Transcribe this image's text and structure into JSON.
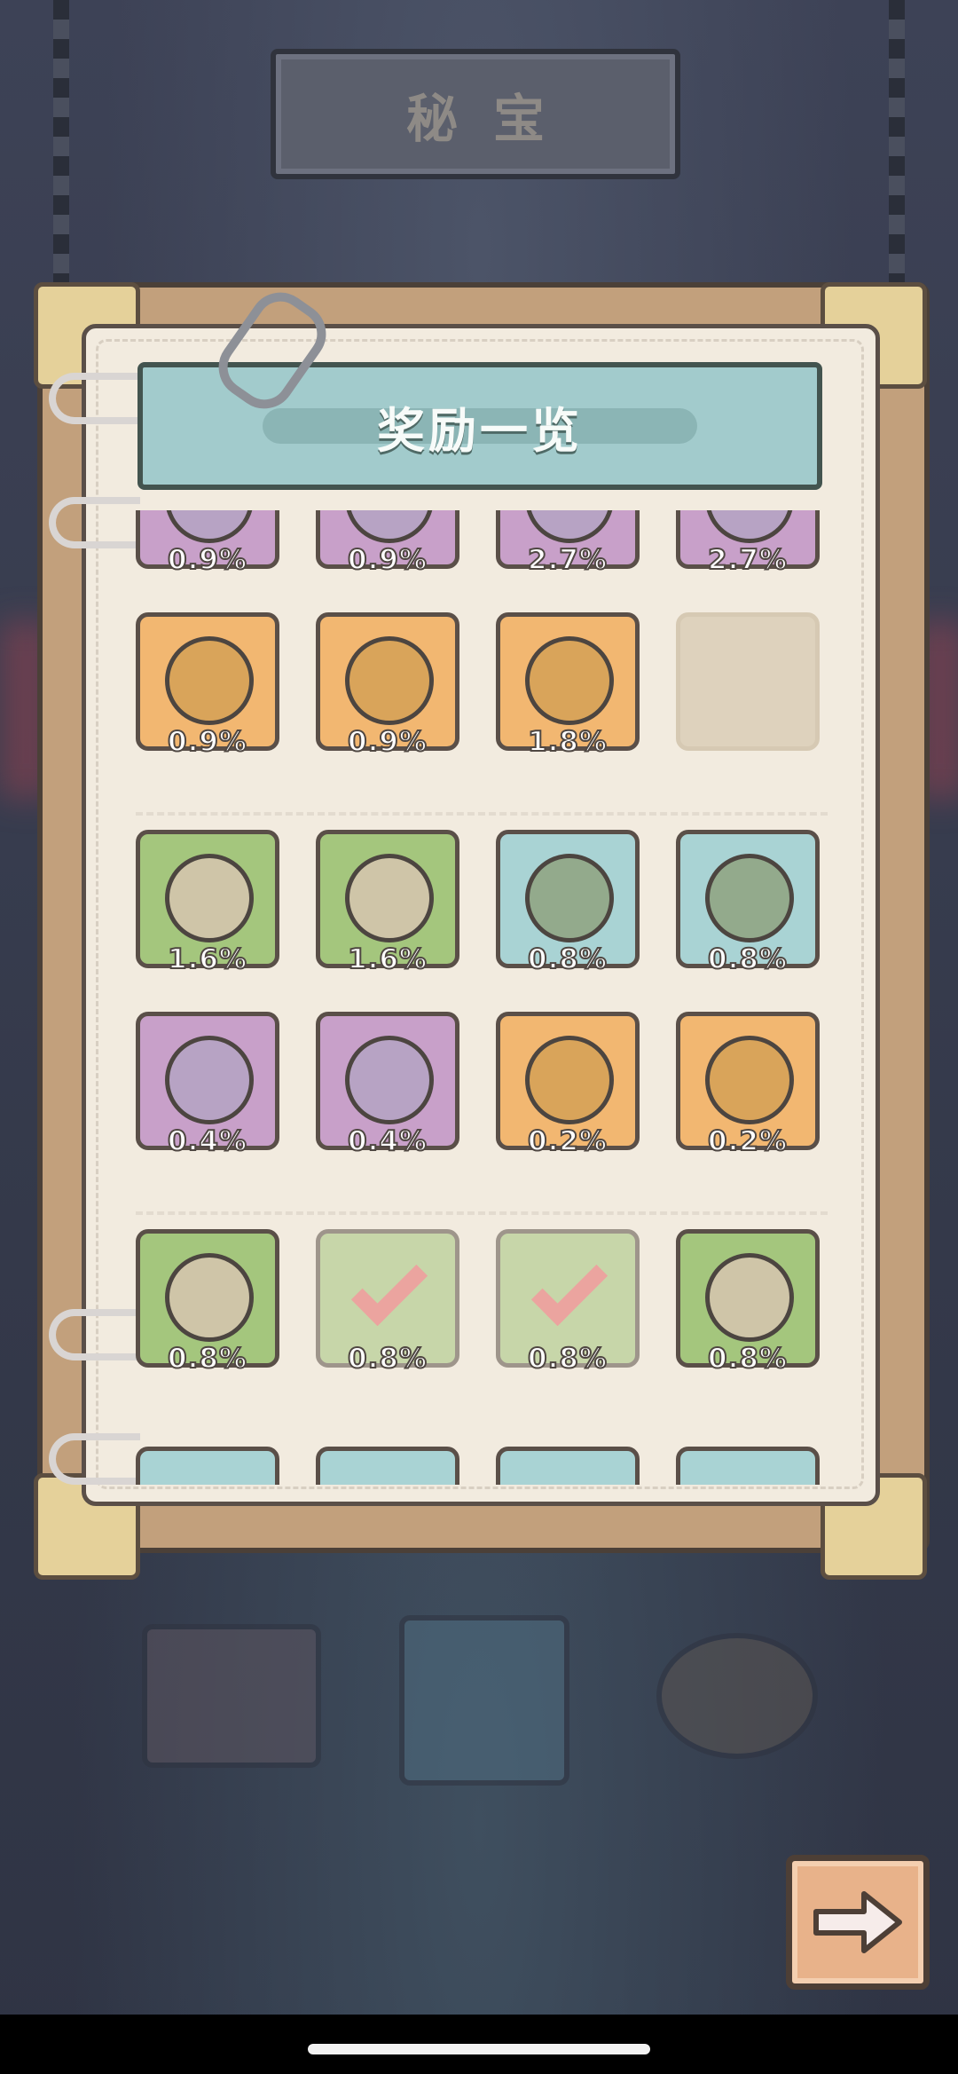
{
  "screen": {
    "title": "秘宝",
    "panel_title": "奖励一览"
  },
  "rewards": [
    {
      "color": "purple",
      "rate": "0.9%",
      "claimed": false,
      "icon": "amulet-icon"
    },
    {
      "color": "purple",
      "rate": "0.9%",
      "claimed": false,
      "icon": "amulet-icon"
    },
    {
      "color": "purple",
      "rate": "2.7%",
      "claimed": false,
      "icon": "talisman-icon"
    },
    {
      "color": "purple",
      "rate": "2.7%",
      "claimed": false,
      "icon": "talisman-icon"
    },
    {
      "color": "orange",
      "rate": "0.9%",
      "claimed": false,
      "icon": "winged-boot-icon"
    },
    {
      "color": "orange",
      "rate": "0.9%",
      "claimed": false,
      "icon": "winged-boot-icon"
    },
    {
      "color": "orange",
      "rate": "1.8%",
      "claimed": false,
      "icon": "ring-icon"
    },
    {
      "color": "empty",
      "rate": "",
      "claimed": false,
      "icon": ""
    },
    {
      "color": "green",
      "rate": "1.6%",
      "claimed": false,
      "icon": "glove-icon"
    },
    {
      "color": "green",
      "rate": "1.6%",
      "claimed": false,
      "icon": "horned-helmet-icon"
    },
    {
      "color": "teal",
      "rate": "0.8%",
      "claimed": false,
      "icon": "leaf-crown-icon"
    },
    {
      "color": "teal",
      "rate": "0.8%",
      "claimed": false,
      "icon": "chain-belt-icon"
    },
    {
      "color": "purple",
      "rate": "0.4%",
      "claimed": false,
      "icon": "hook-shield-icon"
    },
    {
      "color": "purple",
      "rate": "0.4%",
      "claimed": false,
      "icon": "bead-bracelet-icon"
    },
    {
      "color": "orange",
      "rate": "0.2%",
      "claimed": false,
      "icon": "armor-icon"
    },
    {
      "color": "orange",
      "rate": "0.2%",
      "claimed": false,
      "icon": "gear-ring-icon"
    },
    {
      "color": "green",
      "rate": "0.8%",
      "claimed": false,
      "icon": "shell-icon"
    },
    {
      "color": "green",
      "rate": "0.8%",
      "claimed": true,
      "icon": "claimed-check-icon"
    },
    {
      "color": "green",
      "rate": "0.8%",
      "claimed": true,
      "icon": "claimed-check-icon"
    },
    {
      "color": "green",
      "rate": "0.8%",
      "claimed": false,
      "icon": "diving-helmet-icon"
    },
    {
      "color": "teal",
      "rate": "",
      "claimed": false,
      "icon": ""
    },
    {
      "color": "teal",
      "rate": "",
      "claimed": false,
      "icon": ""
    },
    {
      "color": "teal",
      "rate": "",
      "claimed": false,
      "icon": ""
    },
    {
      "color": "teal",
      "rate": "",
      "claimed": false,
      "icon": ""
    }
  ],
  "colors": {
    "purple": "#c8a0c9",
    "orange": "#f2b771",
    "green": "#a4c67d",
    "teal": "#a9d3d4"
  },
  "next_button": {
    "icon": "arrow-right-icon"
  }
}
